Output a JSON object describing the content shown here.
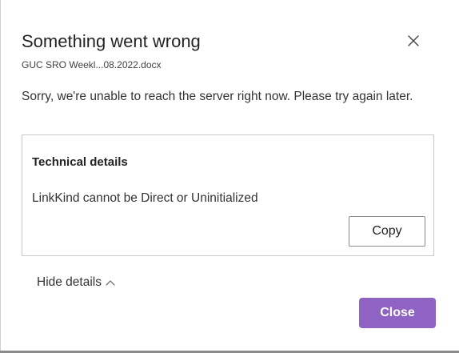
{
  "dialog": {
    "title": "Something went wrong",
    "filename": "GUC SRO Weekl...08.2022.docx",
    "message": "Sorry, we're unable to reach the server right now. Please try again later.",
    "close_icon": "close-x-icon"
  },
  "details": {
    "heading": "Technical details",
    "text": "LinkKind cannot be Direct or Uninitialized",
    "copy_label": "Copy"
  },
  "toggle": {
    "label": "Hide details",
    "icon": "chevron-up-icon"
  },
  "actions": {
    "close_label": "Close"
  },
  "colors": {
    "primary_button": "#8e63c3",
    "text": "#333333",
    "border": "#c8c8c8"
  }
}
